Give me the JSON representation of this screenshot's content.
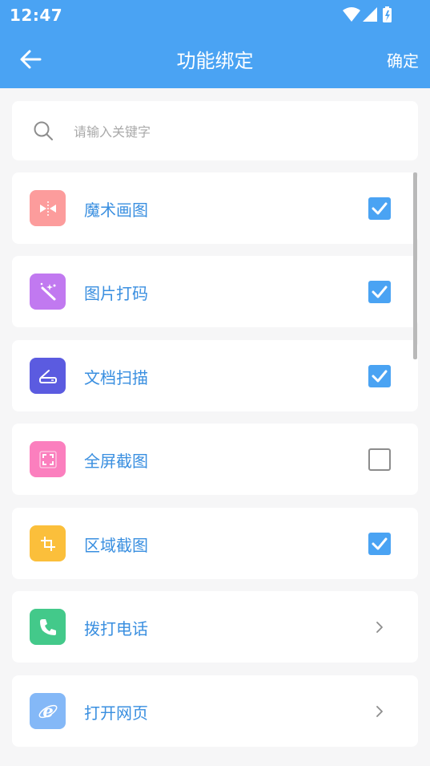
{
  "status_bar": {
    "time": "12:47"
  },
  "header": {
    "title": "功能绑定",
    "confirm_label": "确定"
  },
  "search": {
    "placeholder": "请输入关键字"
  },
  "items": [
    {
      "label": "魔术画图",
      "icon": "magic-mirror-icon",
      "color": "#fc9c9c",
      "control": "checkbox",
      "checked": true
    },
    {
      "label": "图片打码",
      "icon": "magic-wand-icon",
      "color": "#c179f0",
      "control": "checkbox",
      "checked": true
    },
    {
      "label": "文档扫描",
      "icon": "scanner-icon",
      "color": "#5b5be0",
      "control": "checkbox",
      "checked": true
    },
    {
      "label": "全屏截图",
      "icon": "fullscreen-icon",
      "color": "#fb7fbe",
      "control": "checkbox",
      "checked": false
    },
    {
      "label": "区域截图",
      "icon": "crop-icon",
      "color": "#fbbf3b",
      "control": "checkbox",
      "checked": true
    },
    {
      "label": "拨打电话",
      "icon": "phone-icon",
      "color": "#43c98a",
      "control": "chevron"
    },
    {
      "label": "打开网页",
      "icon": "browser-icon",
      "color": "#84b8f7",
      "control": "chevron"
    }
  ],
  "colors": {
    "primary": "#4aa3f3",
    "label": "#3a8fe0",
    "background": "#f6f6f7"
  }
}
